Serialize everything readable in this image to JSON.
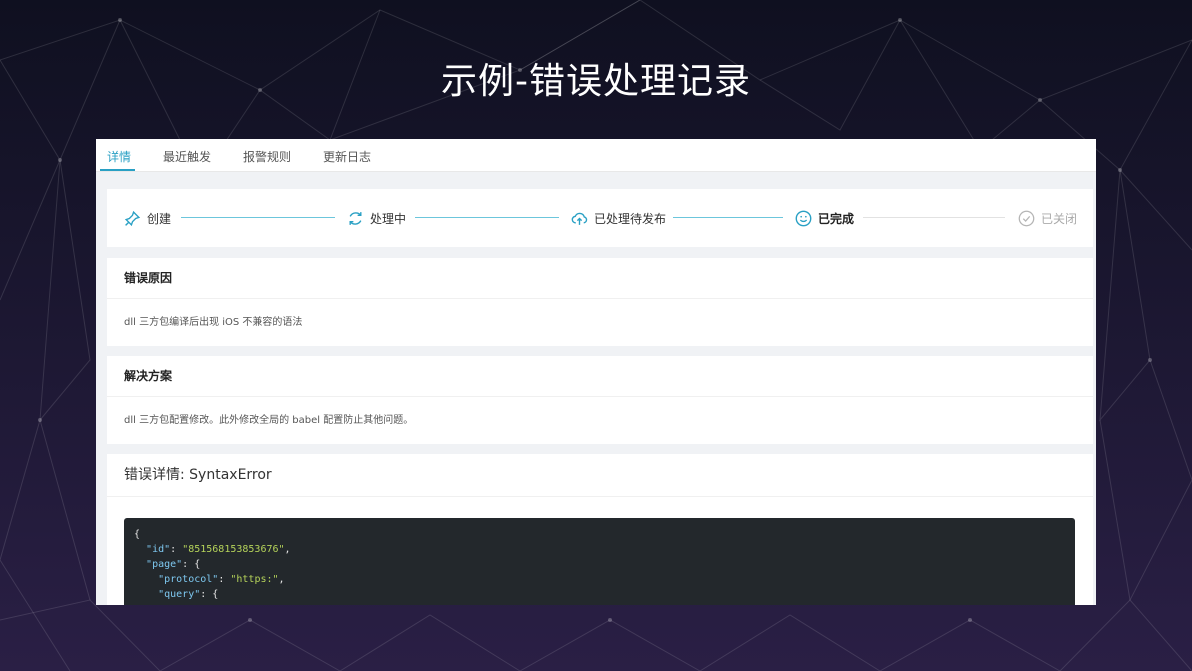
{
  "slide": {
    "title": "示例-错误处理记录"
  },
  "tabs": [
    {
      "label": "详情",
      "active": true
    },
    {
      "label": "最近触发",
      "active": false
    },
    {
      "label": "报警规则",
      "active": false
    },
    {
      "label": "更新日志",
      "active": false
    }
  ],
  "steps": [
    {
      "label": "创建",
      "icon": "pin-icon",
      "state": "done"
    },
    {
      "label": "处理中",
      "icon": "refresh-icon",
      "state": "done"
    },
    {
      "label": "已处理待发布",
      "icon": "cloud-upload-icon",
      "state": "done"
    },
    {
      "label": "已完成",
      "icon": "smile-icon",
      "state": "current"
    },
    {
      "label": "已关闭",
      "icon": "check-circle-icon",
      "state": "pending"
    }
  ],
  "cause": {
    "heading": "错误原因",
    "text": "dll 三方包编译后出现 iOS 不兼容的语法"
  },
  "solution": {
    "heading": "解决方案",
    "text": "dll 三方包配置修改。此外修改全局的 babel 配置防止其他问题。"
  },
  "details": {
    "heading": "错误详情: SyntaxError",
    "code": {
      "open_brace": "{",
      "id_key": "\"id\"",
      "id_value": "\"851568153853676\"",
      "page_key": "\"page\"",
      "protocol_key": "\"protocol\"",
      "protocol_value": "\"https:\"",
      "query_key": "\"query\""
    }
  },
  "colors": {
    "accent": "#29a0c4",
    "background": "#17152a",
    "code_bg": "#23282c",
    "string": "#b5d35a"
  }
}
